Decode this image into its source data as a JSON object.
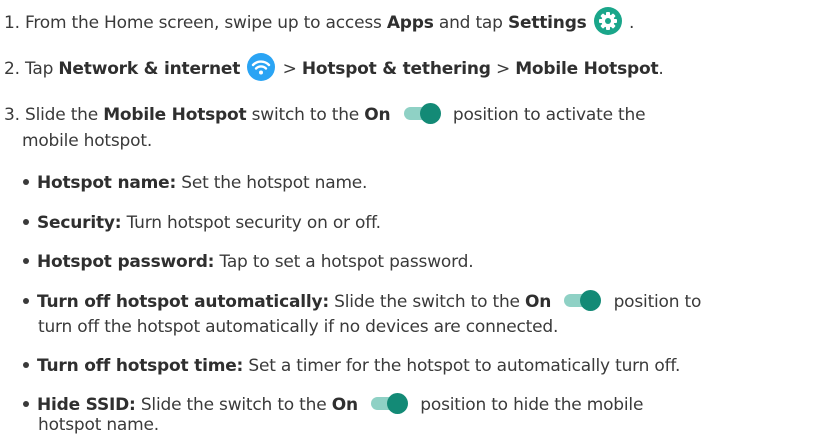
{
  "steps": [
    {
      "parts": [
        "1. From the Home screen, swipe up to access ",
        "Apps",
        " and tap ",
        "Settings",
        " ."
      ]
    },
    {
      "parts": [
        "2. Tap ",
        "Network & internet",
        " > ",
        "Hotspot & tethering",
        " > ",
        "Mobile Hotspot",
        "."
      ]
    },
    {
      "parts": [
        "3. Slide the ",
        "Mobile Hotspot",
        " switch to the ",
        "On",
        " position to activate the",
        "mobile hotspot."
      ]
    }
  ],
  "bullets": [
    {
      "term": "Hotspot name:",
      "text": " Set the hotspot name."
    },
    {
      "term": "Security:",
      "text": " Turn hotspot security on or off."
    },
    {
      "term": "Hotspot password:",
      "text": " Tap to set a hotspot password."
    },
    {
      "term": "Turn off hotspot automatically:",
      "text_a": " Slide the switch to the ",
      "on": "On",
      "text_b": " position to",
      "text_c": "turn off the hotspot automatically if no devices are connected."
    },
    {
      "term": "Turn off hotspot time:",
      "text": " Set a timer for the hotspot to automatically turn off."
    },
    {
      "term": "Hide SSID:",
      "text_a": " Slide the switch to the ",
      "on": "On",
      "text_b": " position to hide the mobile",
      "text_c": "hotspot name."
    }
  ],
  "icons": {
    "settings": "gear-icon",
    "network": "wifi-icon",
    "toggle": "toggle-on-icon"
  },
  "colors": {
    "settings_icon": "#1aa68a",
    "wifi_icon": "#2aa4f4",
    "toggle_track": "#8fd1c5",
    "toggle_knob": "#138a76"
  }
}
